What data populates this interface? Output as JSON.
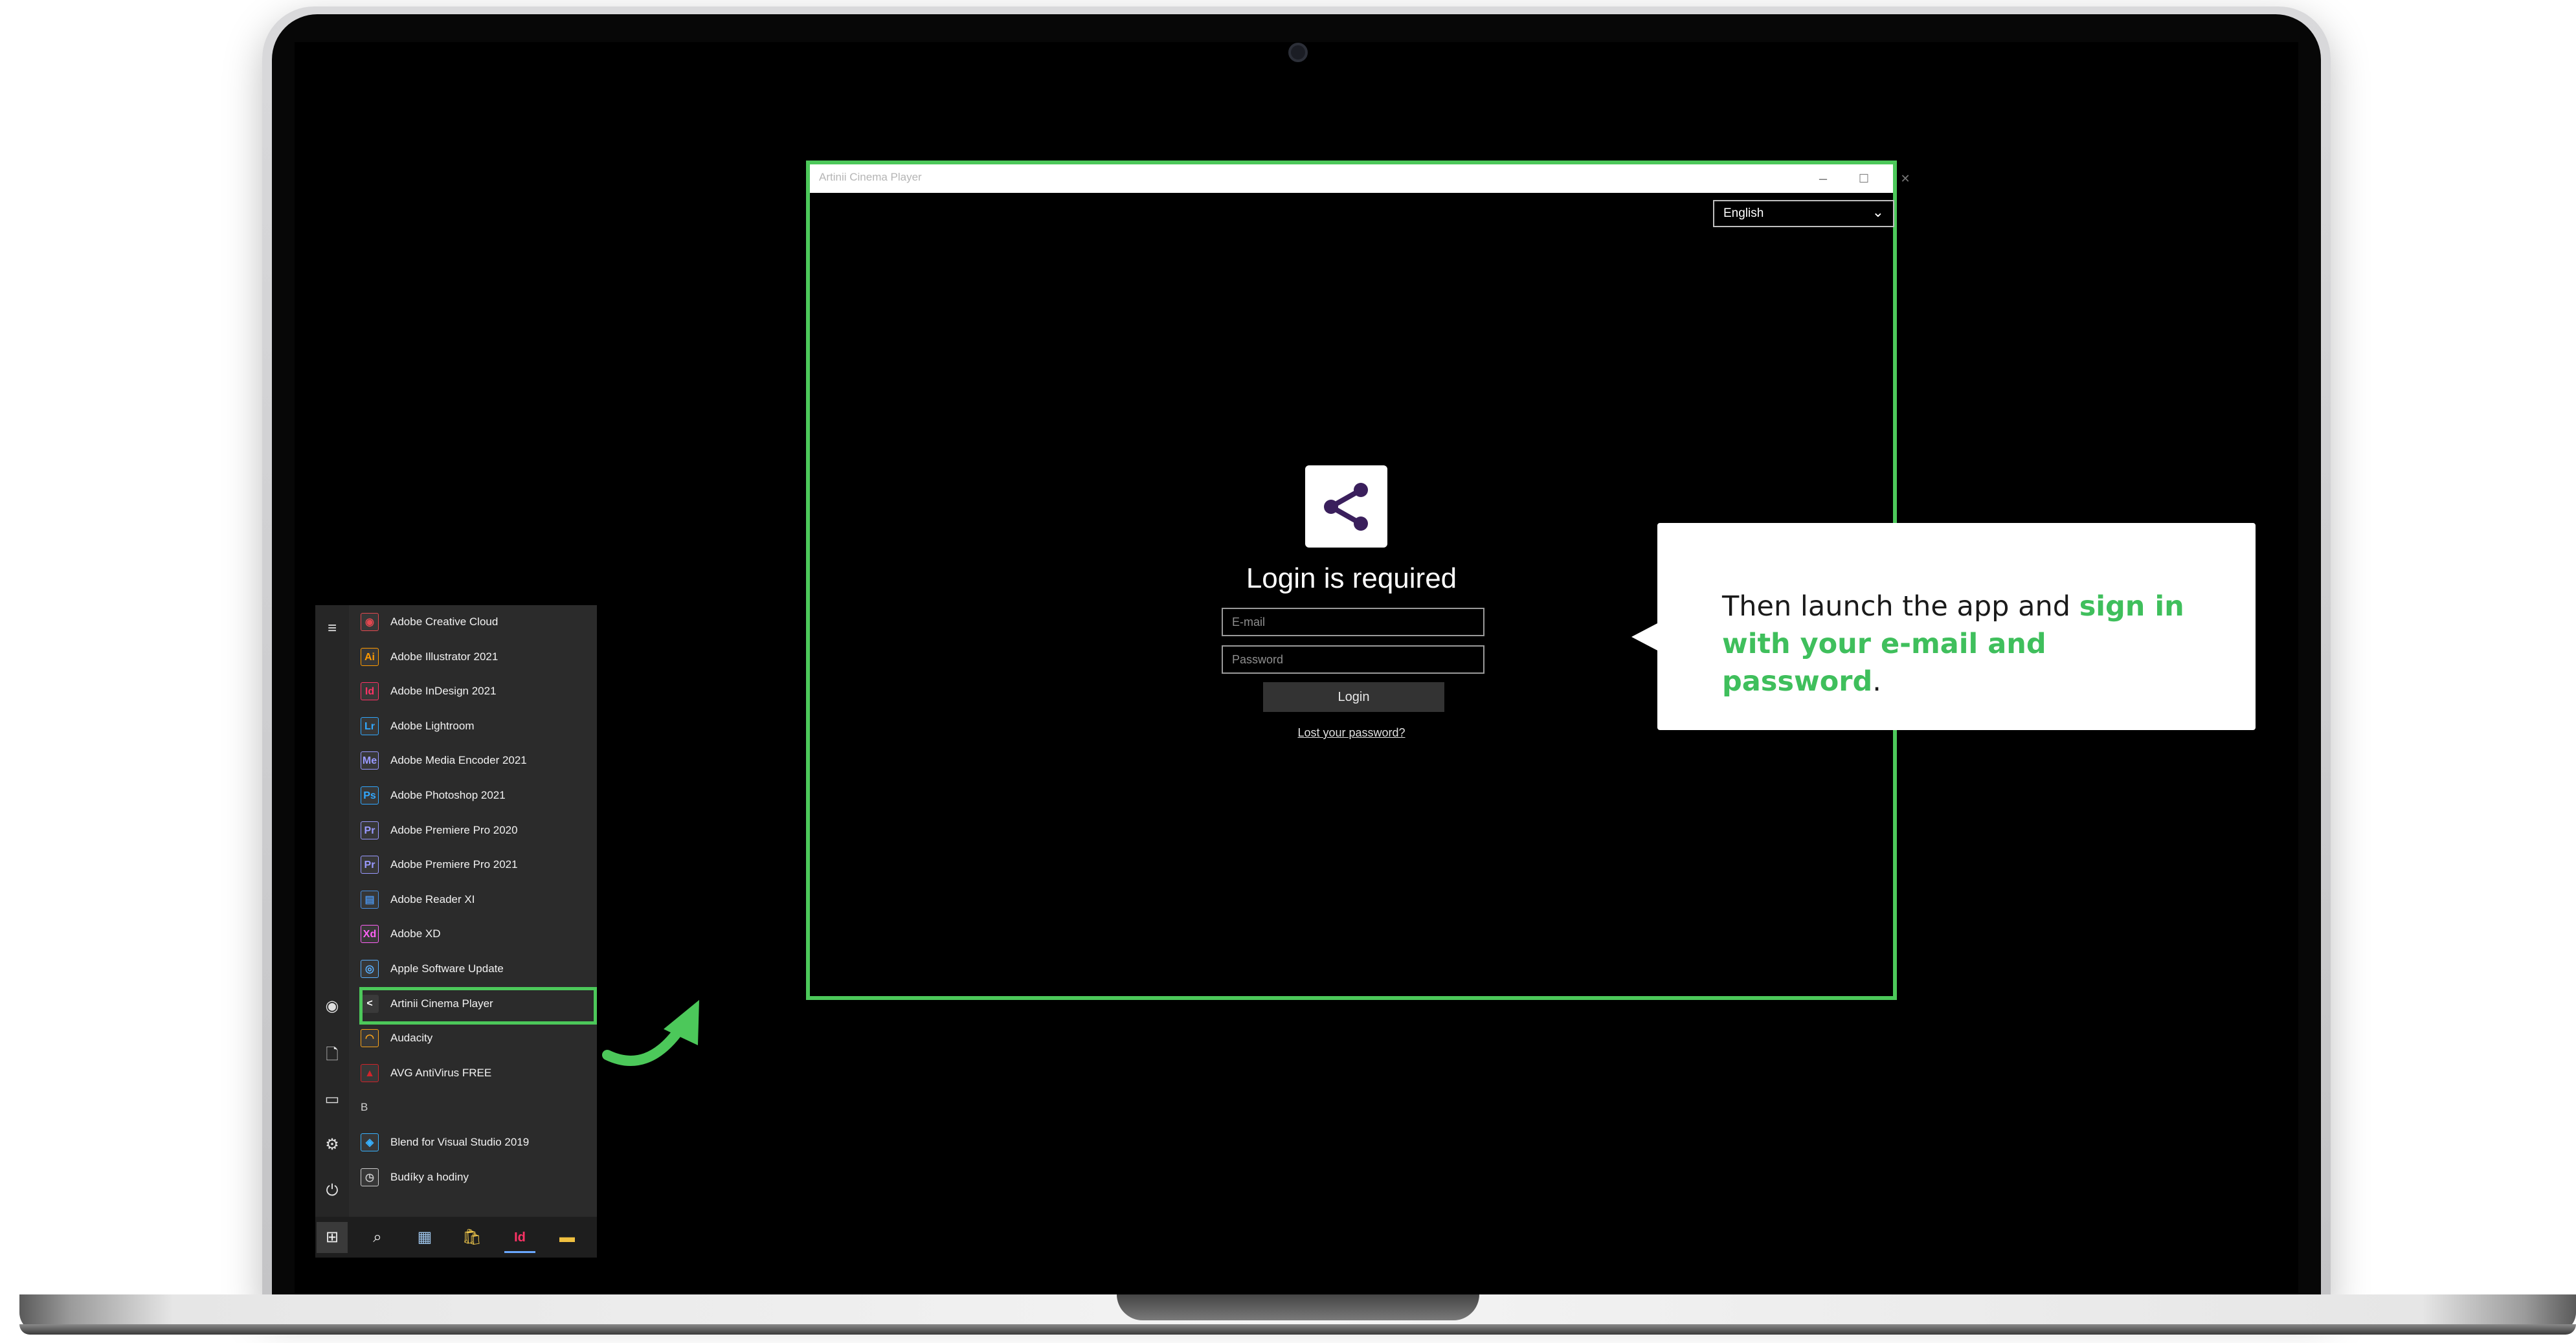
{
  "app_window": {
    "title": "Artinii Cinema Player",
    "controls": {
      "minimize": "–",
      "maximize": "☐",
      "close": "✕"
    },
    "language_selected": "English",
    "login_title": "Login is required",
    "email_placeholder": "E-mail",
    "password_placeholder": "Password",
    "login_button": "Login",
    "lost_password_link": "Lost your password?"
  },
  "callout": {
    "text_plain": "Then launch the app and ",
    "text_highlight": "sign in with your e-mail and password",
    "text_end": "."
  },
  "start_menu": {
    "apps": [
      {
        "label": "Adobe Creative Cloud",
        "icon": "creative-cloud-icon",
        "glyph": "◉",
        "color": "#e34850"
      },
      {
        "label": "Adobe Illustrator 2021",
        "icon": "illustrator-icon",
        "glyph": "Ai",
        "color": "#ff9a00"
      },
      {
        "label": "Adobe InDesign 2021",
        "icon": "indesign-icon",
        "glyph": "Id",
        "color": "#ff3366"
      },
      {
        "label": "Adobe Lightroom",
        "icon": "lightroom-icon",
        "glyph": "Lr",
        "color": "#31a8ff"
      },
      {
        "label": "Adobe Media Encoder 2021",
        "icon": "media-encoder-icon",
        "glyph": "Me",
        "color": "#9999ff"
      },
      {
        "label": "Adobe Photoshop 2021",
        "icon": "photoshop-icon",
        "glyph": "Ps",
        "color": "#31a8ff"
      },
      {
        "label": "Adobe Premiere Pro 2020",
        "icon": "premiere-icon",
        "glyph": "Pr",
        "color": "#9999ff"
      },
      {
        "label": "Adobe Premiere Pro 2021",
        "icon": "premiere-icon",
        "glyph": "Pr",
        "color": "#9999ff"
      },
      {
        "label": "Adobe Reader XI",
        "icon": "reader-icon",
        "glyph": "▤",
        "color": "#4a90e2"
      },
      {
        "label": "Adobe XD",
        "icon": "xd-icon",
        "glyph": "Xd",
        "color": "#ff61f6"
      },
      {
        "label": "Apple Software Update",
        "icon": "apple-update-icon",
        "glyph": "◎",
        "color": "#5ab0ff"
      },
      {
        "label": "Artinii Cinema Player",
        "icon": "artinii-icon",
        "glyph": "<",
        "color": "#ffffff"
      },
      {
        "label": "Audacity",
        "icon": "audacity-icon",
        "glyph": "◠",
        "color": "#f7a21b"
      },
      {
        "label": "AVG AntiVirus FREE",
        "icon": "avg-icon",
        "glyph": "▲",
        "color": "#d2232a"
      },
      {
        "label": "B",
        "icon": "section-header",
        "glyph": "",
        "color": ""
      },
      {
        "label": "Blend for Visual Studio 2019",
        "icon": "blend-icon",
        "glyph": "◈",
        "color": "#38b2ff"
      },
      {
        "label": "Budíky a hodiny",
        "icon": "alarm-clock-icon",
        "glyph": "◷",
        "color": "#cccccc"
      }
    ]
  }
}
